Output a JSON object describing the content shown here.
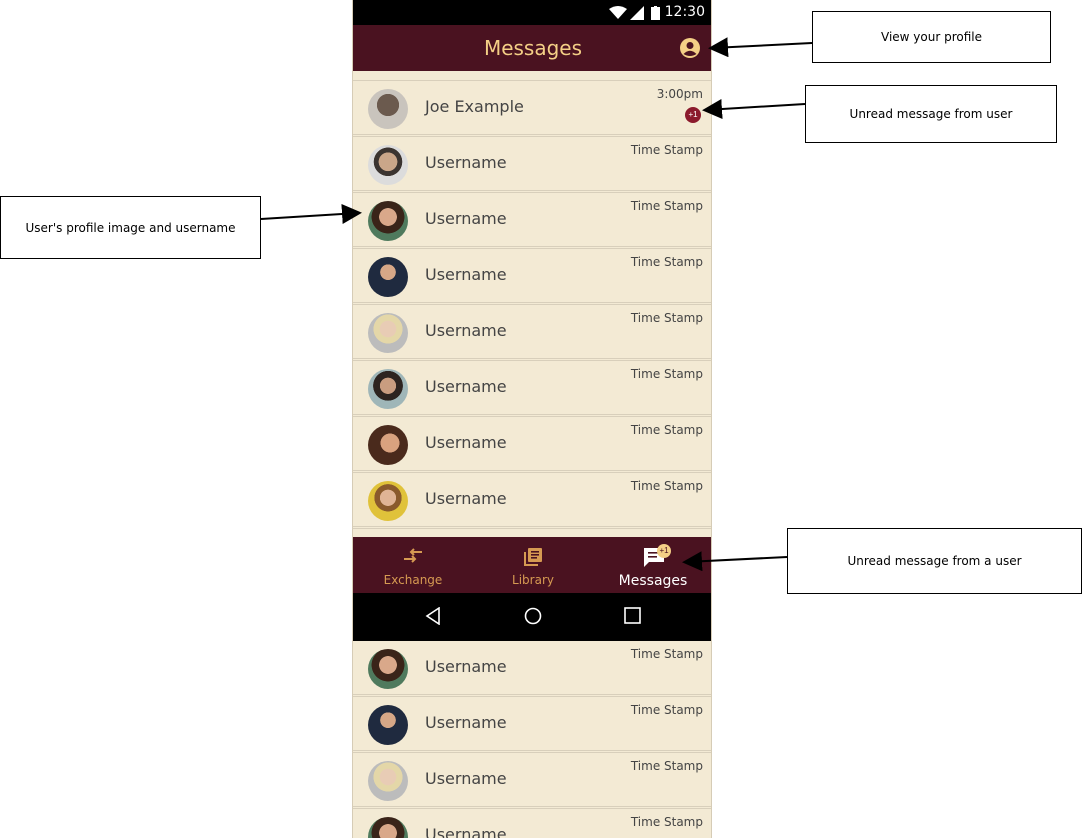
{
  "status_bar": {
    "time": "12:30"
  },
  "app_bar": {
    "title": "Messages"
  },
  "conversations": [
    {
      "name": "Joe Example",
      "time": "3:00pm",
      "unread": "+1"
    },
    {
      "name": "Username",
      "time": "Time Stamp"
    },
    {
      "name": "Username",
      "time": "Time Stamp"
    },
    {
      "name": "Username",
      "time": "Time Stamp"
    },
    {
      "name": "Username",
      "time": "Time Stamp"
    },
    {
      "name": "Username",
      "time": "Time Stamp"
    },
    {
      "name": "Username",
      "time": "Time Stamp"
    },
    {
      "name": "Username",
      "time": "Time Stamp"
    }
  ],
  "scrolled_conversations": [
    {
      "name": "Username",
      "time": "Time Stamp"
    },
    {
      "name": "Username",
      "time": "Time Stamp"
    },
    {
      "name": "Username",
      "time": "Time Stamp"
    },
    {
      "name": "Username",
      "time": "Time Stamp"
    }
  ],
  "bottom_nav": {
    "items": [
      {
        "label": "Exchange"
      },
      {
        "label": "Library"
      },
      {
        "label": "Messages",
        "badge": "+1"
      }
    ]
  },
  "annotations": {
    "profile": "View your profile",
    "unread_user": "Unread message from user",
    "profile_image": "User's profile image and username",
    "unread_nav": "Unread message from a user"
  },
  "colors": {
    "app_bar": "#4a1220",
    "title": "#f4cf86",
    "list_background": "#f3ead4",
    "unread_badge": "#8b1a2c",
    "nav_inactive": "#d69a52"
  },
  "icons": [
    "wifi-icon",
    "signal-icon",
    "battery-icon",
    "account-circle-icon",
    "exchange-icon",
    "library-icon",
    "message-icon",
    "back-icon",
    "home-icon",
    "recents-icon"
  ]
}
